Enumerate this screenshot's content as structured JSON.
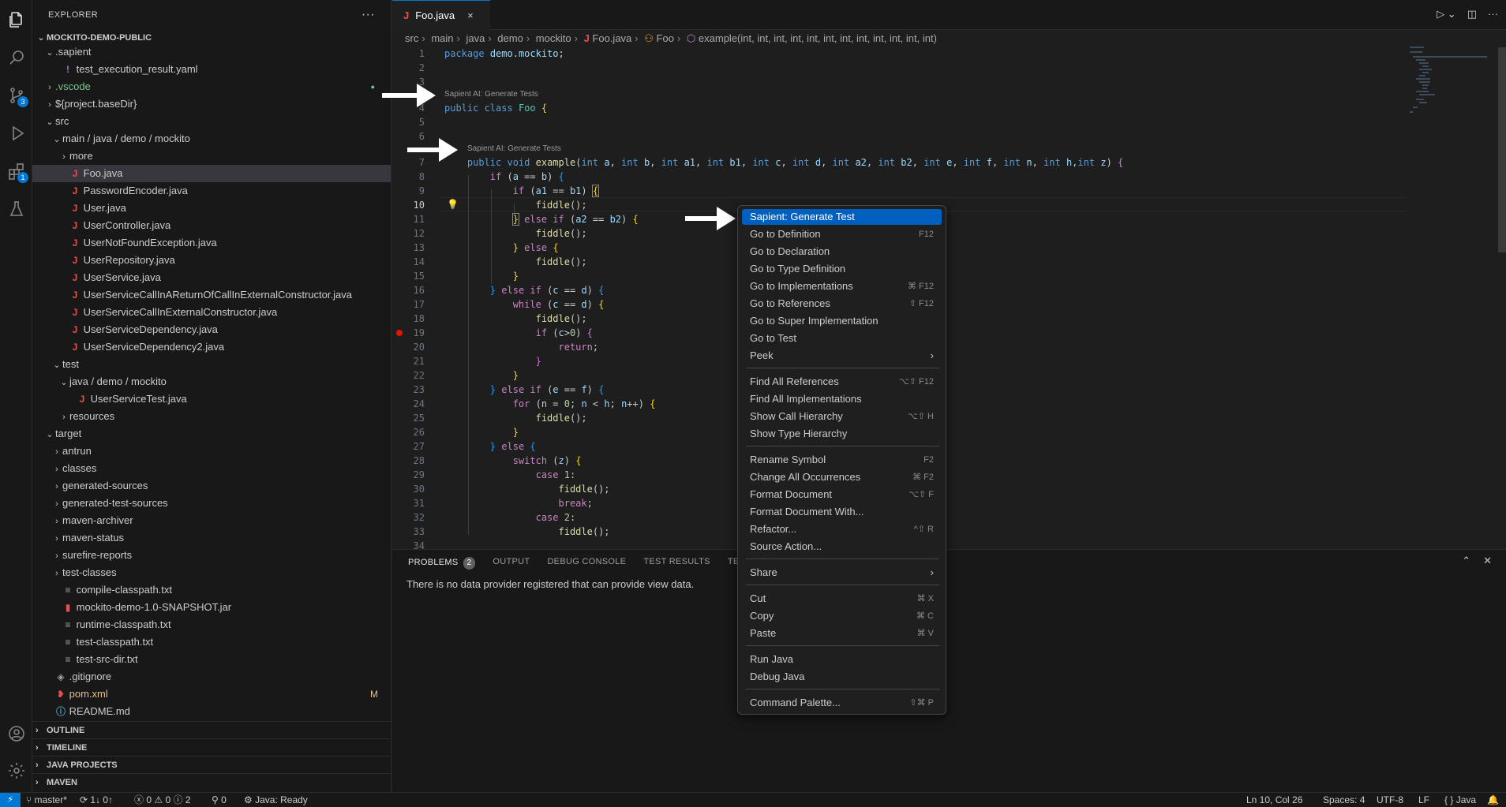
{
  "explorer": {
    "title": "EXPLORER",
    "more": "···",
    "root": "MOCKITO-DEMO-PUBLIC",
    "items": [
      {
        "label": ".sapient",
        "depth": 1,
        "chev": "v",
        "kind": "folder"
      },
      {
        "label": "test_execution_result.yaml",
        "depth": 2,
        "chev": "",
        "kind": "yaml"
      },
      {
        "label": ".vscode",
        "depth": 1,
        "chev": ">",
        "kind": "folder-green"
      },
      {
        "label": "${project.baseDir}",
        "depth": 1,
        "chev": ">",
        "kind": "folder"
      },
      {
        "label": "src",
        "depth": 1,
        "chev": "v",
        "kind": "folder"
      },
      {
        "label": "main / java / demo / mockito",
        "depth": 2,
        "chev": "v",
        "kind": "folder"
      },
      {
        "label": "more",
        "depth": 3,
        "chev": ">",
        "kind": "folder"
      },
      {
        "label": "Foo.java",
        "depth": 3,
        "chev": "",
        "kind": "java",
        "selected": true
      },
      {
        "label": "PasswordEncoder.java",
        "depth": 3,
        "chev": "",
        "kind": "java"
      },
      {
        "label": "User.java",
        "depth": 3,
        "chev": "",
        "kind": "java"
      },
      {
        "label": "UserController.java",
        "depth": 3,
        "chev": "",
        "kind": "java"
      },
      {
        "label": "UserNotFoundException.java",
        "depth": 3,
        "chev": "",
        "kind": "java"
      },
      {
        "label": "UserRepository.java",
        "depth": 3,
        "chev": "",
        "kind": "java"
      },
      {
        "label": "UserService.java",
        "depth": 3,
        "chev": "",
        "kind": "java"
      },
      {
        "label": "UserServiceCallInAReturnOfCallInExternalConstructor.java",
        "depth": 3,
        "chev": "",
        "kind": "java"
      },
      {
        "label": "UserServiceCallInExternalConstructor.java",
        "depth": 3,
        "chev": "",
        "kind": "java"
      },
      {
        "label": "UserServiceDependency.java",
        "depth": 3,
        "chev": "",
        "kind": "java"
      },
      {
        "label": "UserServiceDependency2.java",
        "depth": 3,
        "chev": "",
        "kind": "java"
      },
      {
        "label": "test",
        "depth": 2,
        "chev": "v",
        "kind": "folder"
      },
      {
        "label": "java / demo / mockito",
        "depth": 3,
        "chev": "v",
        "kind": "folder"
      },
      {
        "label": "UserServiceTest.java",
        "depth": 4,
        "chev": "",
        "kind": "java"
      },
      {
        "label": "resources",
        "depth": 3,
        "chev": ">",
        "kind": "folder"
      },
      {
        "label": "target",
        "depth": 1,
        "chev": "v",
        "kind": "folder"
      },
      {
        "label": "antrun",
        "depth": 2,
        "chev": ">",
        "kind": "folder"
      },
      {
        "label": "classes",
        "depth": 2,
        "chev": ">",
        "kind": "folder"
      },
      {
        "label": "generated-sources",
        "depth": 2,
        "chev": ">",
        "kind": "folder"
      },
      {
        "label": "generated-test-sources",
        "depth": 2,
        "chev": ">",
        "kind": "folder"
      },
      {
        "label": "maven-archiver",
        "depth": 2,
        "chev": ">",
        "kind": "folder"
      },
      {
        "label": "maven-status",
        "depth": 2,
        "chev": ">",
        "kind": "folder"
      },
      {
        "label": "surefire-reports",
        "depth": 2,
        "chev": ">",
        "kind": "folder"
      },
      {
        "label": "test-classes",
        "depth": 2,
        "chev": ">",
        "kind": "folder"
      },
      {
        "label": "compile-classpath.txt",
        "depth": 2,
        "chev": "",
        "kind": "txt"
      },
      {
        "label": "mockito-demo-1.0-SNAPSHOT.jar",
        "depth": 2,
        "chev": "",
        "kind": "jar"
      },
      {
        "label": "runtime-classpath.txt",
        "depth": 2,
        "chev": "",
        "kind": "txt"
      },
      {
        "label": "test-classpath.txt",
        "depth": 2,
        "chev": "",
        "kind": "txt"
      },
      {
        "label": "test-src-dir.txt",
        "depth": 2,
        "chev": "",
        "kind": "txt"
      },
      {
        "label": ".gitignore",
        "depth": 1,
        "chev": "",
        "kind": "git"
      },
      {
        "label": "pom.xml",
        "depth": 1,
        "chev": "",
        "kind": "xml",
        "badge": "M"
      },
      {
        "label": "README.md",
        "depth": 1,
        "chev": "",
        "kind": "info"
      }
    ],
    "sections": [
      "OUTLINE",
      "TIMELINE",
      "JAVA PROJECTS",
      "MAVEN"
    ]
  },
  "activity": {
    "scm_badge": "3",
    "ext_badge": "1"
  },
  "editor": {
    "tab": "Foo.java",
    "tab_close": "×",
    "breadcrumb": [
      "src",
      "main",
      "java",
      "demo",
      "mockito",
      "Foo.java",
      "Foo",
      "example(int, int, int, int, int, int, int, int, int, int, int, int)"
    ],
    "lens_text": "Sapient AI: Generate Tests",
    "line_numbers": [
      "1",
      "2",
      "3",
      "4",
      "5",
      "6",
      "7",
      "8",
      "9",
      "10",
      "11",
      "12",
      "13",
      "14",
      "15",
      "16",
      "17",
      "18",
      "19",
      "20",
      "21",
      "22",
      "23",
      "24",
      "25",
      "26",
      "27",
      "28",
      "29",
      "30",
      "31",
      "32",
      "33",
      "34"
    ],
    "current_line": "10"
  },
  "context_menu": {
    "items": [
      {
        "label": "Sapient: Generate Test",
        "kb": "",
        "highlight": true
      },
      {
        "label": "Go to Definition",
        "kb": "F12"
      },
      {
        "label": "Go to Declaration",
        "kb": ""
      },
      {
        "label": "Go to Type Definition",
        "kb": ""
      },
      {
        "label": "Go to Implementations",
        "kb": "⌘ F12"
      },
      {
        "label": "Go to References",
        "kb": "⇧ F12"
      },
      {
        "label": "Go to Super Implementation",
        "kb": ""
      },
      {
        "label": "Go to Test",
        "kb": ""
      },
      {
        "label": "Peek",
        "kb": "",
        "submenu": true
      },
      {
        "sep": true
      },
      {
        "label": "Find All References",
        "kb": "⌥⇧ F12"
      },
      {
        "label": "Find All Implementations",
        "kb": ""
      },
      {
        "label": "Show Call Hierarchy",
        "kb": "⌥⇧ H"
      },
      {
        "label": "Show Type Hierarchy",
        "kb": ""
      },
      {
        "sep": true
      },
      {
        "label": "Rename Symbol",
        "kb": "F2"
      },
      {
        "label": "Change All Occurrences",
        "kb": "⌘ F2"
      },
      {
        "label": "Format Document",
        "kb": "⌥⇧ F"
      },
      {
        "label": "Format Document With...",
        "kb": ""
      },
      {
        "label": "Refactor...",
        "kb": "^⇧ R"
      },
      {
        "label": "Source Action...",
        "kb": ""
      },
      {
        "sep": true
      },
      {
        "label": "Share",
        "kb": "",
        "submenu": true
      },
      {
        "sep": true
      },
      {
        "label": "Cut",
        "kb": "⌘ X"
      },
      {
        "label": "Copy",
        "kb": "⌘ C"
      },
      {
        "label": "Paste",
        "kb": "⌘ V"
      },
      {
        "sep": true
      },
      {
        "label": "Run Java",
        "kb": ""
      },
      {
        "label": "Debug Java",
        "kb": ""
      },
      {
        "sep": true
      },
      {
        "label": "Command Palette...",
        "kb": "⇧⌘ P"
      }
    ]
  },
  "panel": {
    "tabs": [
      "PROBLEMS",
      "OUTPUT",
      "DEBUG CONSOLE",
      "TEST RESULTS",
      "TE"
    ],
    "problems_count": "2",
    "message": "There is no data provider registered that can provide view data."
  },
  "status": {
    "branch": "master*",
    "sync": "1↓ 0↑",
    "errors": "0",
    "warnings": "0",
    "infos": "2",
    "ports": "0",
    "java": "Java: Ready",
    "position": "Ln 10, Col 26",
    "spaces": "Spaces: 4",
    "encoding": "UTF-8",
    "eol": "LF",
    "language": "Java"
  }
}
